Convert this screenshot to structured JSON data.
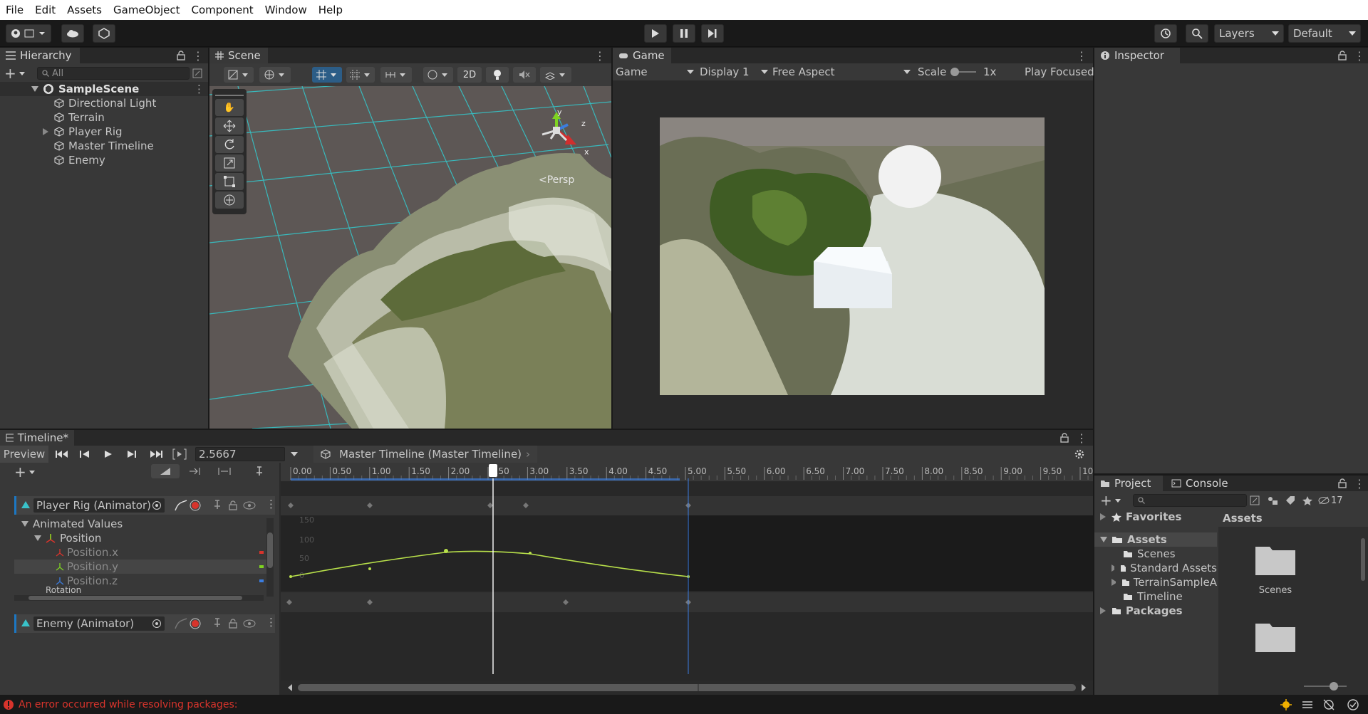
{
  "menu": [
    "File",
    "Edit",
    "Assets",
    "GameObject",
    "Component",
    "Window",
    "Help"
  ],
  "toolbar": {
    "layers": "Layers",
    "layout": "Default"
  },
  "hierarchy": {
    "tab": "Hierarchy",
    "search_placeholder": "All",
    "scene": "SampleScene",
    "items": [
      "Directional Light",
      "Terrain",
      "Player Rig",
      "Master Timeline",
      "Enemy"
    ]
  },
  "scene": {
    "tab": "Scene",
    "persp": "<Persp",
    "mode_2d": "2D",
    "gizmo": {
      "x": "x",
      "y": "y",
      "z": "z"
    }
  },
  "game": {
    "tab": "Game",
    "mode": "Game",
    "display": "Display 1",
    "aspect": "Free Aspect",
    "scale_label": "Scale",
    "scale_value": "1x",
    "play_mode": "Play Focused"
  },
  "inspector": {
    "tab": "Inspector"
  },
  "timeline": {
    "tab": "Timeline*",
    "preview": "Preview",
    "time": "2.5667",
    "asset": "Master Timeline (Master Timeline)",
    "ruler": [
      "0.00",
      "0.50",
      "1.00",
      "1.50",
      "2.00",
      "2.50",
      "3.00",
      "3.50",
      "4.00",
      "4.50",
      "5.00",
      "5.50",
      "6.00",
      "6.50",
      "7.00",
      "7.50",
      "8.00",
      "8.50",
      "9.00",
      "9.50",
      "10"
    ],
    "tracks": [
      {
        "name": "Player Rig (Animator)"
      },
      {
        "name": "Enemy (Animator)"
      }
    ],
    "curve_tree": [
      "Animated Values",
      "Position",
      "Position.x",
      "Position.y",
      "Position.z",
      "Rotation"
    ],
    "curve_axis": [
      "150",
      "100",
      "50",
      "0"
    ]
  },
  "project": {
    "tab_project": "Project",
    "tab_console": "Console",
    "hidden_count": "17",
    "favorites": "Favorites",
    "assets": "Assets",
    "folders": [
      "Scenes",
      "Standard Assets",
      "TerrainSampleA",
      "Timeline"
    ],
    "packages": "Packages",
    "grid_header": "Assets",
    "grid_items": [
      "Scenes",
      ""
    ]
  },
  "status": {
    "error": "An error occurred while resolving packages:"
  },
  "colors": {
    "accent": "#2c5d87",
    "error": "#d8342c",
    "curve": "#b8e04a",
    "grid": "#2fd3d3"
  }
}
